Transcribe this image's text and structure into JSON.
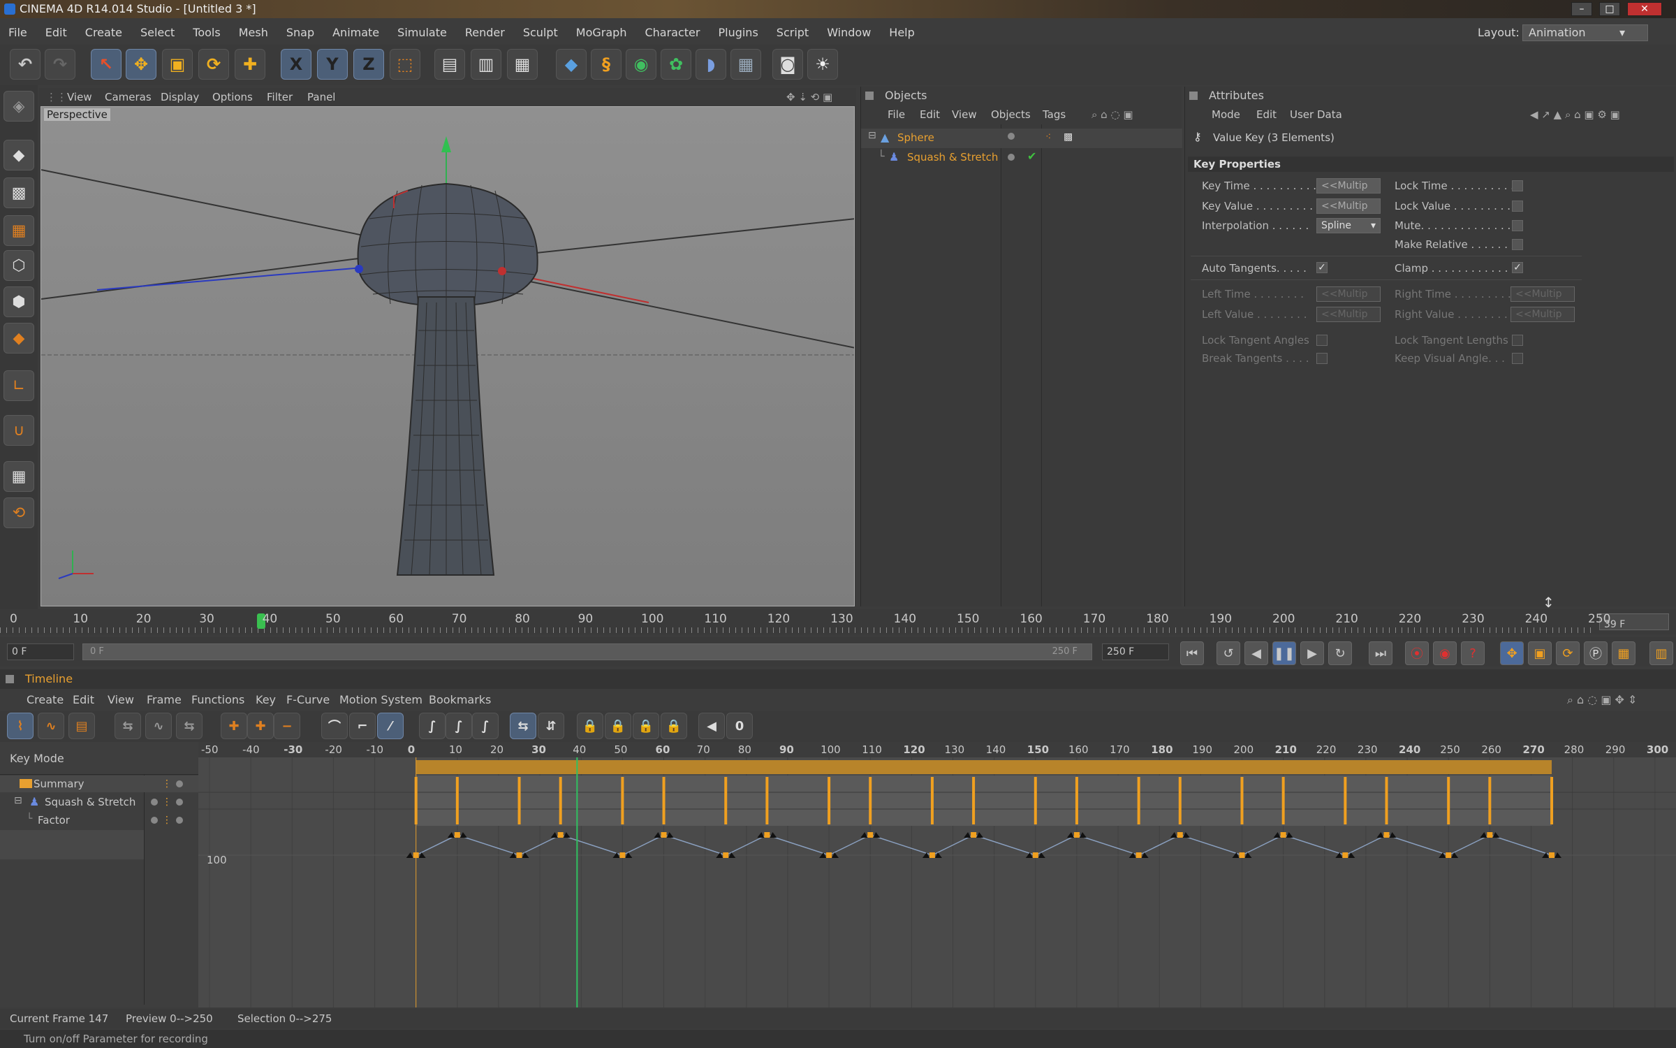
{
  "window": {
    "title": "CINEMA 4D R14.014 Studio - [Untitled 3 *]"
  },
  "menu": [
    "File",
    "Edit",
    "Create",
    "Select",
    "Tools",
    "Mesh",
    "Snap",
    "Animate",
    "Simulate",
    "Render",
    "Sculpt",
    "MoGraph",
    "Character",
    "Plugins",
    "Script",
    "Window",
    "Help"
  ],
  "layout": {
    "label": "Layout:",
    "value": "Animation"
  },
  "toolbar": {
    "x_label": "X",
    "y_label": "Y",
    "z_label": "Z"
  },
  "viewport": {
    "menu": [
      "View",
      "Cameras",
      "Display",
      "Options",
      "Filter",
      "Panel"
    ],
    "name": "Perspective"
  },
  "objects": {
    "title": "Objects",
    "menu": [
      "File",
      "Edit",
      "View",
      "Objects",
      "Tags"
    ],
    "items": [
      {
        "name": "Sphere"
      },
      {
        "name": "Squash & Stretch"
      }
    ]
  },
  "attributes": {
    "title": "Attributes",
    "menu": [
      "Mode",
      "Edit",
      "User Data"
    ],
    "subtitle": "Value Key (3 Elements)",
    "section": "Key Properties",
    "key_time": "Key Time . . . . . . . . . .",
    "key_value": "Key Value . . . . . . . . .",
    "interpolation": "Interpolation . . . . . .",
    "spline": "Spline",
    "multi": "<<Multip",
    "lock_time": "Lock Time . . . . . . . . . .",
    "lock_value": "Lock Value . . . . . . . . .",
    "mute": "Mute. . . . . . . . . . . . . .",
    "make_relative": "Make Relative . . . . . .",
    "auto_tangents": "Auto Tangents. . . . .",
    "clamp": "Clamp . . . . . . . . . . . . .",
    "left_time": "Left  Time . . . . . . . .",
    "right_time": "Right Time . . . . . . . . .",
    "left_value": "Left  Value . . . . . . . .",
    "right_value": "Right Value . . . . . . . .",
    "lock_tangent_angles": "Lock Tangent Angles",
    "lock_tangent_lengths": "Lock Tangent Lengths",
    "break_tangents": "Break Tangents . . . .",
    "keep_visual_angle": "Keep Visual Angle. . ."
  },
  "ruler": {
    "labels": [
      "0",
      "10",
      "20",
      "30",
      "40",
      "50",
      "60",
      "70",
      "80",
      "90",
      "100",
      "110",
      "120",
      "130",
      "140",
      "150",
      "160",
      "170",
      "180",
      "190",
      "200",
      "210",
      "220",
      "230",
      "240",
      "250"
    ],
    "current": "39 F"
  },
  "transport": {
    "start": "0 F",
    "range_start": "0 F",
    "range_end": "250 F",
    "end": "250 F"
  },
  "timeline": {
    "title": "Timeline",
    "menu": [
      "Create",
      "Edit",
      "View",
      "Frame",
      "Functions",
      "Key",
      "F-Curve",
      "Motion System",
      "Bookmarks"
    ],
    "key_mode": "Key Mode",
    "scale": [
      "-50",
      "-40",
      "-30",
      "-20",
      "-10",
      "0",
      "10",
      "20",
      "30",
      "40",
      "50",
      "60",
      "70",
      "80",
      "90",
      "100",
      "110",
      "120",
      "130",
      "140",
      "150",
      "160",
      "170",
      "180",
      "190",
      "200",
      "210",
      "220",
      "230",
      "240",
      "250",
      "260",
      "270",
      "280",
      "290",
      "300"
    ],
    "tracks": [
      "Summary",
      "Squash & Stretch",
      "Factor"
    ],
    "value_label": "100"
  },
  "status": {
    "current_frame": "Current Frame  147",
    "preview": "Preview  0-->250",
    "selection": "Selection 0-->275"
  },
  "hint": "Turn on/off Parameter for recording"
}
